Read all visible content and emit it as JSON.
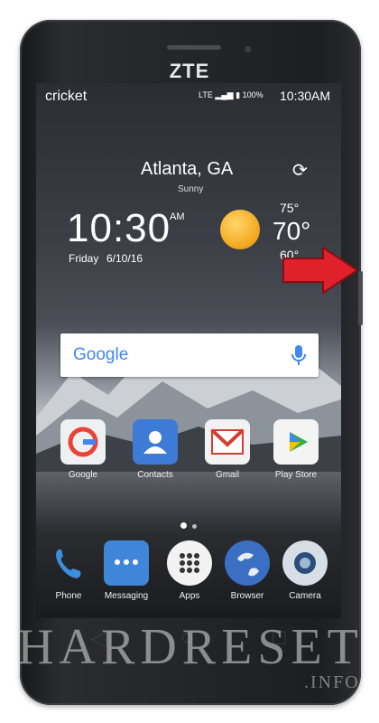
{
  "device": {
    "brand": "ZTE"
  },
  "status_bar": {
    "carrier": "cricket",
    "network": "LTE",
    "battery": "100%",
    "time": "10:30AM"
  },
  "weather": {
    "city": "Atlanta, GA",
    "condition": "Sunny",
    "high": "75°",
    "temp": "70°",
    "low": "60°"
  },
  "clock": {
    "time": "10:30",
    "ampm": "AM",
    "day": "Friday",
    "date": "6/10/16"
  },
  "search": {
    "logo_text": "Google"
  },
  "home_apps": [
    {
      "label": "Google"
    },
    {
      "label": "Contacts"
    },
    {
      "label": "Gmail"
    },
    {
      "label": "Play Store"
    }
  ],
  "dock_apps": [
    {
      "label": "Phone"
    },
    {
      "label": "Messaging"
    },
    {
      "label": "Apps"
    },
    {
      "label": "Browser"
    },
    {
      "label": "Camera"
    }
  ],
  "watermark": {
    "main": "HARDRESET",
    "suffix": ".INFO"
  },
  "colors": {
    "arrow": "#e0202a",
    "google_blue": "#4285F4"
  }
}
